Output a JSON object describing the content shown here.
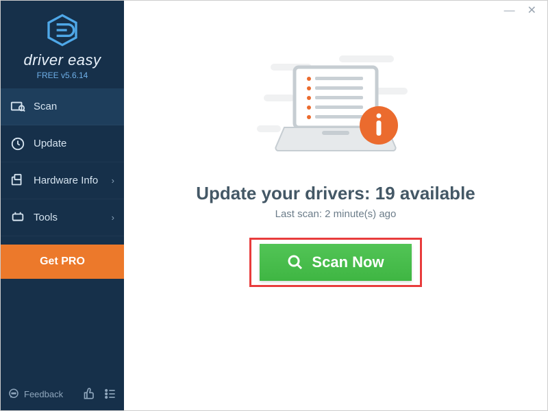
{
  "app": {
    "name": "driver easy",
    "edition_line": "FREE v5.6.14"
  },
  "sidebar": {
    "items": [
      {
        "label": "Scan",
        "has_chevron": false
      },
      {
        "label": "Update",
        "has_chevron": false
      },
      {
        "label": "Hardware Info",
        "has_chevron": true
      },
      {
        "label": "Tools",
        "has_chevron": true
      }
    ],
    "get_pro_label": "Get PRO",
    "feedback_label": "Feedback"
  },
  "main": {
    "headline_prefix": "Update your drivers: ",
    "available_count": 19,
    "headline_suffix": " available",
    "last_scan_text": "Last scan: 2 minute(s) ago",
    "scan_button_label": "Scan Now"
  }
}
